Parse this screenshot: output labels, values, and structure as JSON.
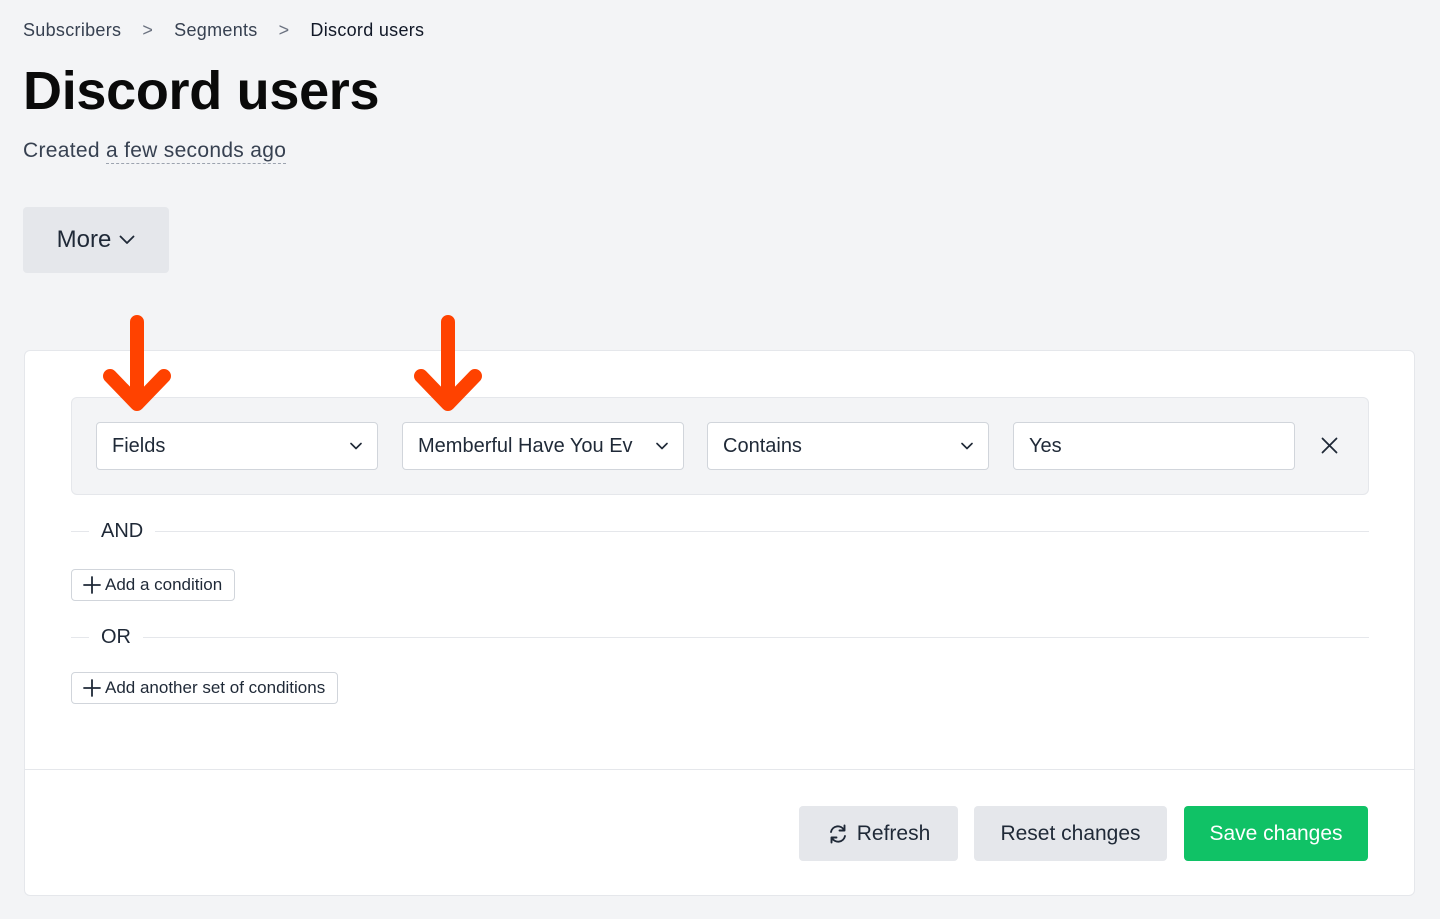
{
  "breadcrumb": [
    {
      "label": "Subscribers"
    },
    {
      "label": "Segments"
    },
    {
      "label": "Discord users"
    }
  ],
  "breadcrumb_separator": ">",
  "page": {
    "title": "Discord users",
    "created_prefix": "Created",
    "created_time": "a few seconds ago"
  },
  "more_button": {
    "label": "More",
    "icon": "chevron-down-icon"
  },
  "condition_group": {
    "conditions": [
      {
        "type_select": "Fields",
        "field_select": "Memberful Have You Ev",
        "operator_select": "Contains",
        "value_input": "Yes",
        "remove_icon": "close-icon"
      }
    ]
  },
  "and_label": "AND",
  "or_label": "OR",
  "add_condition_label": "Add a condition",
  "add_condition_set_label": "Add another set of conditions",
  "footer": {
    "refresh_label": "Refresh",
    "reset_label": "Reset changes",
    "save_label": "Save changes"
  },
  "colors": {
    "accent_save": "#10c266",
    "annotation_arrow": "#ff4200",
    "page_bg": "#f3f4f6"
  }
}
